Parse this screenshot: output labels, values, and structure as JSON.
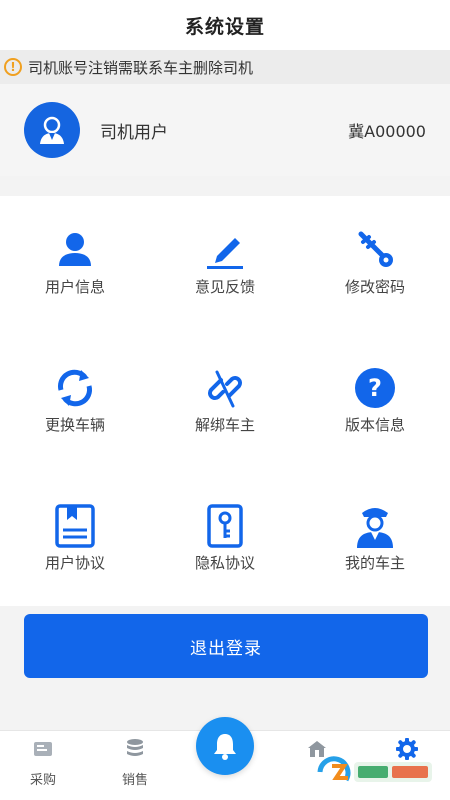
{
  "header": {
    "title": "系统设置"
  },
  "notice": {
    "text": "司机账号注销需联系车主删除司机"
  },
  "user": {
    "name": "司机用户",
    "plate": "冀A00000"
  },
  "menu": [
    {
      "label": "用户信息",
      "icon": "user-icon"
    },
    {
      "label": "意见反馈",
      "icon": "pencil-icon"
    },
    {
      "label": "修改密码",
      "icon": "key-icon"
    },
    {
      "label": "更换车辆",
      "icon": "refresh-icon"
    },
    {
      "label": "解绑车主",
      "icon": "unlink-icon"
    },
    {
      "label": "版本信息",
      "icon": "question-icon"
    },
    {
      "label": "用户协议",
      "icon": "book-icon"
    },
    {
      "label": "隐私协议",
      "icon": "lock-key-icon"
    },
    {
      "label": "我的车主",
      "icon": "driver-icon"
    }
  ],
  "logout_label": "退出登录",
  "tabs": [
    {
      "label": "采购",
      "icon": "purchase-icon"
    },
    {
      "label": "销售",
      "icon": "database-icon"
    },
    {
      "label": "",
      "icon": "bell-icon"
    },
    {
      "label": "",
      "icon": "house-icon"
    },
    {
      "label": "",
      "icon": "gear-icon"
    }
  ],
  "colors": {
    "primary": "#1266ea",
    "accent": "#1a8ff0",
    "warning": "#f0a020"
  }
}
